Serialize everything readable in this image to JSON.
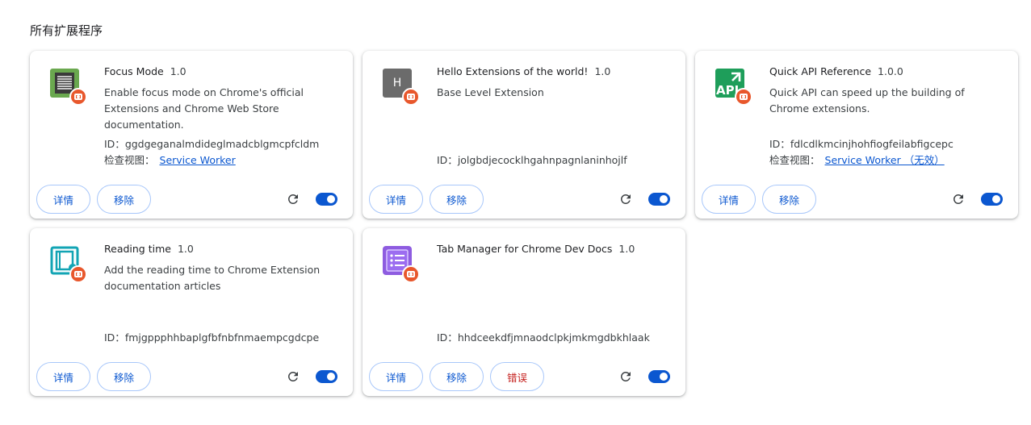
{
  "section_title": "所有扩展程序",
  "labels": {
    "details": "详情",
    "remove": "移除",
    "errors": "错误",
    "id_prefix": "ID：",
    "inspect_prefix": "检查视图："
  },
  "colors": {
    "accent": "#0b57d0",
    "badge": "#e8572c",
    "error": "#c5221f"
  },
  "extensions": [
    {
      "name": "Focus Mode",
      "version": "1.0",
      "description": "Enable focus mode on Chrome's official Extensions and Chrome Web Store documentation.",
      "id": "ggdgeganalmdideglmadcblgmcpfcldm",
      "inspect_link": "Service Worker",
      "icon": "focus-mode-icon",
      "enabled": true
    },
    {
      "name": "Hello Extensions of the world!",
      "version": "1.0",
      "description": "Base Level Extension",
      "id": "jolgbdjecocklhgahnpagnlaninhojlf",
      "icon_letter": "H",
      "icon": "letter-h-icon",
      "enabled": true
    },
    {
      "name": "Quick API Reference",
      "version": "1.0.0",
      "description": "Quick API can speed up the building of Chrome extensions.",
      "id": "fdlcdlkmcinjhohfiogfeilabfigcepc",
      "inspect_link": "Service Worker （无效）",
      "icon_text": "API",
      "icon": "api-icon",
      "enabled": true
    },
    {
      "name": "Reading time",
      "version": "1.0",
      "description": "Add the reading time to Chrome Extension documentation articles",
      "id": "fmjgppphhbaplgfbfnbfnmaempcgdcpe",
      "icon": "reading-time-icon",
      "enabled": true
    },
    {
      "name": "Tab Manager for Chrome Dev Docs",
      "version": "1.0",
      "description": "",
      "id": "hhdceekdfjmnaodclpkjmkmgdbkhlaak",
      "icon": "tab-manager-icon",
      "enabled": true,
      "has_errors": true
    }
  ]
}
